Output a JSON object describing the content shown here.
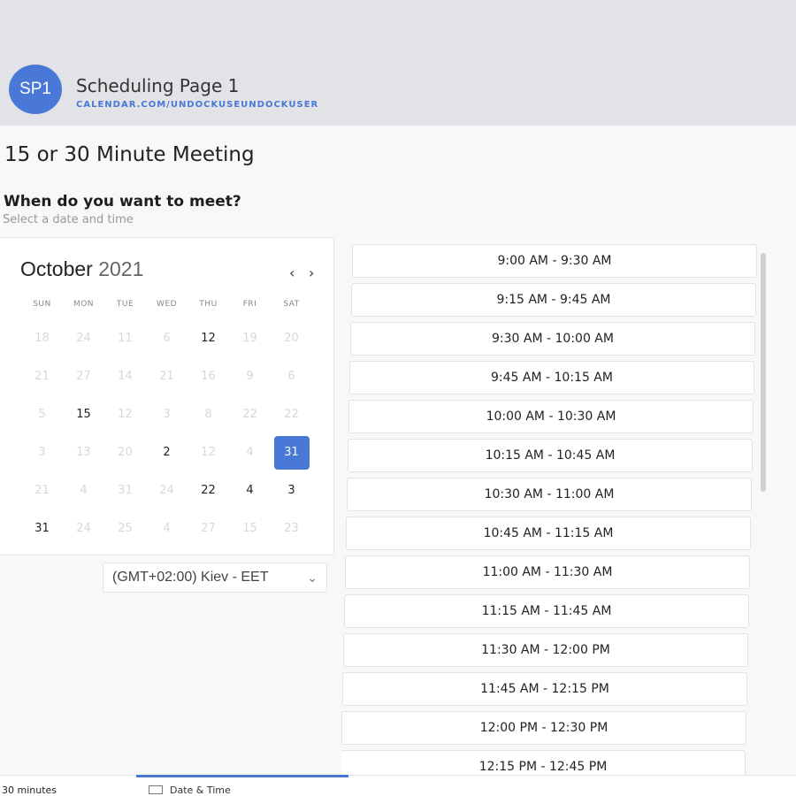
{
  "header": {
    "avatar_initials": "SP1",
    "page_title": "Scheduling Page 1",
    "page_url": "CALENDAR.COM/UNDOCKUSEUNDOCKUSER"
  },
  "meeting": {
    "title": "15 or 30 Minute Meeting",
    "prompt": "When do you want to meet?",
    "subprompt": "Select a date and time"
  },
  "calendar": {
    "month": "October",
    "year": "2021",
    "prev_icon": "‹",
    "next_icon": "›",
    "weekdays": [
      "SUN",
      "MON",
      "TUE",
      "WED",
      "THU",
      "FRI",
      "SAT"
    ],
    "weeks": [
      [
        "18",
        "24",
        "11",
        "6",
        "12",
        "19",
        "20"
      ],
      [
        "21",
        "27",
        "14",
        "21",
        "16",
        "9",
        "6"
      ],
      [
        "5",
        "15",
        "12",
        "3",
        "8",
        "22",
        "22"
      ],
      [
        "3",
        "13",
        "20",
        "2",
        "12",
        "4",
        "31"
      ],
      [
        "21",
        "4",
        "31",
        "24",
        "22",
        "4",
        "3"
      ],
      [
        "31",
        "24",
        "25",
        "4",
        "27",
        "15",
        "23"
      ]
    ],
    "states": [
      [
        "dim",
        "dim",
        "dim",
        "dim",
        "avail",
        "dim",
        "dim"
      ],
      [
        "dim",
        "dim",
        "dim",
        "dim",
        "dim",
        "dim",
        "dim"
      ],
      [
        "dim",
        "avail",
        "dim",
        "dim",
        "dim",
        "dim",
        "dim"
      ],
      [
        "dim",
        "dim",
        "dim",
        "avail",
        "dim",
        "dim",
        "selected"
      ],
      [
        "dim",
        "dim",
        "dim",
        "dim",
        "avail",
        "avail",
        "avail"
      ],
      [
        "avail",
        "dim",
        "dim",
        "dim",
        "dim",
        "dim",
        "dim"
      ]
    ]
  },
  "timezone": {
    "selected": "(GMT+02:00) Kiev - EET",
    "chevron": "⌄"
  },
  "time_slots": [
    "9:00 AM - 9:30 AM",
    "9:15 AM - 9:45 AM",
    "9:30 AM - 10:00 AM",
    "9:45 AM - 10:15 AM",
    "10:00 AM - 10:30 AM",
    "10:15 AM - 10:45 AM",
    "10:30 AM - 11:00 AM",
    "10:45 AM - 11:15 AM",
    "11:00 AM - 11:30 AM",
    "11:15 AM - 11:45 AM",
    "11:30 AM - 12:00 PM",
    "11:45 AM - 12:15 PM",
    "12:00 PM - 12:30 PM",
    "12:15 PM - 12:45 PM"
  ],
  "footer": {
    "duration": "30 minutes",
    "step_label": "Date & Time"
  },
  "colors": {
    "accent": "#4a78d6",
    "header_bg": "#e2e3e7"
  }
}
